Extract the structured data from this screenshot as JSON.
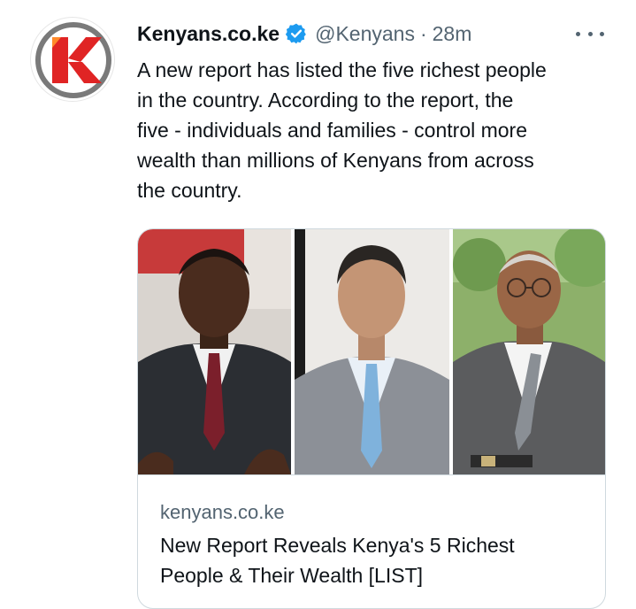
{
  "tweet": {
    "author_name": "Kenyans.co.ke",
    "verified": true,
    "handle": "@Kenyans",
    "separator": "·",
    "time": "28m",
    "text": "A new report has listed the five richest people\nin the country. According to the report, the\nfive - individuals and families - control more\nwealth than millions of Kenyans from across\nthe country."
  },
  "card": {
    "domain": "kenyans.co.ke",
    "title": "New Report Reveals Kenya's 5 Richest\nPeople & Their Wealth [LIST]"
  },
  "icons": {
    "avatar_logo": "kenyans-k-logo",
    "verified": "verified-badge-icon",
    "more": "more-options-icon"
  },
  "colors": {
    "brand_red": "#e02424",
    "verified_blue": "#1d9bf0",
    "secondary_text": "#536471",
    "border": "#cfd9de"
  }
}
